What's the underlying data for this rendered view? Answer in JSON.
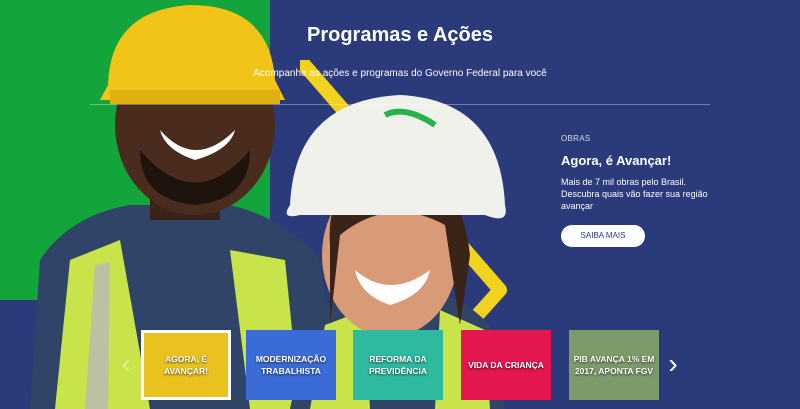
{
  "header": {
    "title": "Programas e Ações",
    "subtitle": "Acompanhe as ações e programas do Governo Federal para você"
  },
  "feature": {
    "category": "OBRAS",
    "title": "Agora, é Avançar!",
    "description": "Mais de 7 mil obras pelo Brasil. Descubra quais vão fazer sua região avançar",
    "button": "SAIBA MAIS"
  },
  "carousel": {
    "prev_icon": "chevron-left-icon",
    "next_icon": "chevron-right-icon",
    "items": [
      {
        "label": "AGORA, É AVANÇAR!",
        "active": true,
        "color": "#e9c21f"
      },
      {
        "label": "MODERNIZAÇÃO TRABALHISTA",
        "active": false,
        "color": "#3b6bd6"
      },
      {
        "label": "REFORMA DA PREVIDÊNCIA",
        "active": false,
        "color": "#2fb99f"
      },
      {
        "label": "VIDA DA CRIANÇA",
        "active": false,
        "color": "#e4164f"
      },
      {
        "label": "PIB AVANÇA 1% EM 2017, APONTA FGV",
        "active": false,
        "color": "#7d9a6b"
      }
    ]
  },
  "colors": {
    "background": "#2b3a7a",
    "green": "#13a53b",
    "yellow": "#f2d21c"
  }
}
